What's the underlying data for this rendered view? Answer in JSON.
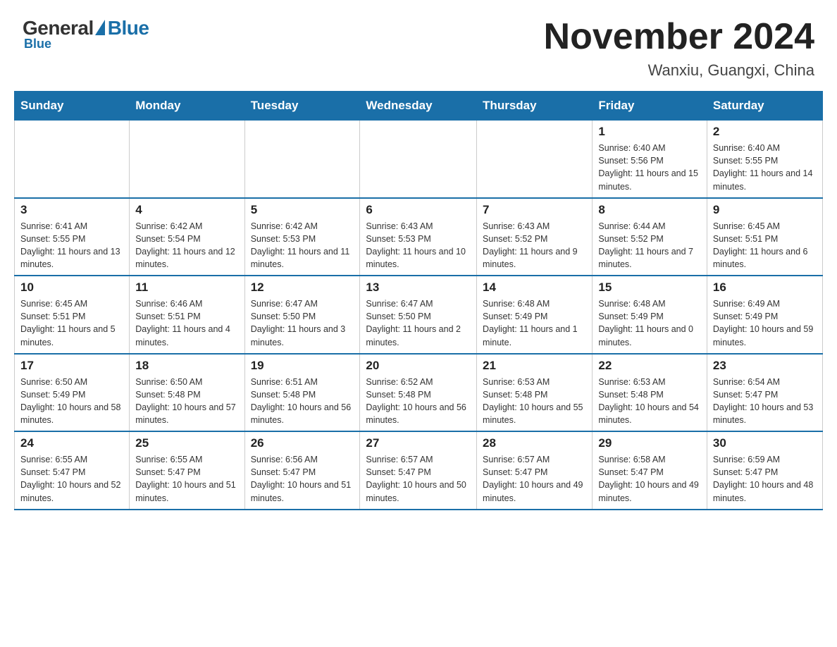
{
  "header": {
    "logo": {
      "general": "General",
      "blue": "Blue"
    },
    "title": "November 2024",
    "subtitle": "Wanxiu, Guangxi, China"
  },
  "days_of_week": [
    "Sunday",
    "Monday",
    "Tuesday",
    "Wednesday",
    "Thursday",
    "Friday",
    "Saturday"
  ],
  "weeks": [
    [
      {
        "day": "",
        "info": ""
      },
      {
        "day": "",
        "info": ""
      },
      {
        "day": "",
        "info": ""
      },
      {
        "day": "",
        "info": ""
      },
      {
        "day": "",
        "info": ""
      },
      {
        "day": "1",
        "info": "Sunrise: 6:40 AM\nSunset: 5:56 PM\nDaylight: 11 hours and 15 minutes."
      },
      {
        "day": "2",
        "info": "Sunrise: 6:40 AM\nSunset: 5:55 PM\nDaylight: 11 hours and 14 minutes."
      }
    ],
    [
      {
        "day": "3",
        "info": "Sunrise: 6:41 AM\nSunset: 5:55 PM\nDaylight: 11 hours and 13 minutes."
      },
      {
        "day": "4",
        "info": "Sunrise: 6:42 AM\nSunset: 5:54 PM\nDaylight: 11 hours and 12 minutes."
      },
      {
        "day": "5",
        "info": "Sunrise: 6:42 AM\nSunset: 5:53 PM\nDaylight: 11 hours and 11 minutes."
      },
      {
        "day": "6",
        "info": "Sunrise: 6:43 AM\nSunset: 5:53 PM\nDaylight: 11 hours and 10 minutes."
      },
      {
        "day": "7",
        "info": "Sunrise: 6:43 AM\nSunset: 5:52 PM\nDaylight: 11 hours and 9 minutes."
      },
      {
        "day": "8",
        "info": "Sunrise: 6:44 AM\nSunset: 5:52 PM\nDaylight: 11 hours and 7 minutes."
      },
      {
        "day": "9",
        "info": "Sunrise: 6:45 AM\nSunset: 5:51 PM\nDaylight: 11 hours and 6 minutes."
      }
    ],
    [
      {
        "day": "10",
        "info": "Sunrise: 6:45 AM\nSunset: 5:51 PM\nDaylight: 11 hours and 5 minutes."
      },
      {
        "day": "11",
        "info": "Sunrise: 6:46 AM\nSunset: 5:51 PM\nDaylight: 11 hours and 4 minutes."
      },
      {
        "day": "12",
        "info": "Sunrise: 6:47 AM\nSunset: 5:50 PM\nDaylight: 11 hours and 3 minutes."
      },
      {
        "day": "13",
        "info": "Sunrise: 6:47 AM\nSunset: 5:50 PM\nDaylight: 11 hours and 2 minutes."
      },
      {
        "day": "14",
        "info": "Sunrise: 6:48 AM\nSunset: 5:49 PM\nDaylight: 11 hours and 1 minute."
      },
      {
        "day": "15",
        "info": "Sunrise: 6:48 AM\nSunset: 5:49 PM\nDaylight: 11 hours and 0 minutes."
      },
      {
        "day": "16",
        "info": "Sunrise: 6:49 AM\nSunset: 5:49 PM\nDaylight: 10 hours and 59 minutes."
      }
    ],
    [
      {
        "day": "17",
        "info": "Sunrise: 6:50 AM\nSunset: 5:49 PM\nDaylight: 10 hours and 58 minutes."
      },
      {
        "day": "18",
        "info": "Sunrise: 6:50 AM\nSunset: 5:48 PM\nDaylight: 10 hours and 57 minutes."
      },
      {
        "day": "19",
        "info": "Sunrise: 6:51 AM\nSunset: 5:48 PM\nDaylight: 10 hours and 56 minutes."
      },
      {
        "day": "20",
        "info": "Sunrise: 6:52 AM\nSunset: 5:48 PM\nDaylight: 10 hours and 56 minutes."
      },
      {
        "day": "21",
        "info": "Sunrise: 6:53 AM\nSunset: 5:48 PM\nDaylight: 10 hours and 55 minutes."
      },
      {
        "day": "22",
        "info": "Sunrise: 6:53 AM\nSunset: 5:48 PM\nDaylight: 10 hours and 54 minutes."
      },
      {
        "day": "23",
        "info": "Sunrise: 6:54 AM\nSunset: 5:47 PM\nDaylight: 10 hours and 53 minutes."
      }
    ],
    [
      {
        "day": "24",
        "info": "Sunrise: 6:55 AM\nSunset: 5:47 PM\nDaylight: 10 hours and 52 minutes."
      },
      {
        "day": "25",
        "info": "Sunrise: 6:55 AM\nSunset: 5:47 PM\nDaylight: 10 hours and 51 minutes."
      },
      {
        "day": "26",
        "info": "Sunrise: 6:56 AM\nSunset: 5:47 PM\nDaylight: 10 hours and 51 minutes."
      },
      {
        "day": "27",
        "info": "Sunrise: 6:57 AM\nSunset: 5:47 PM\nDaylight: 10 hours and 50 minutes."
      },
      {
        "day": "28",
        "info": "Sunrise: 6:57 AM\nSunset: 5:47 PM\nDaylight: 10 hours and 49 minutes."
      },
      {
        "day": "29",
        "info": "Sunrise: 6:58 AM\nSunset: 5:47 PM\nDaylight: 10 hours and 49 minutes."
      },
      {
        "day": "30",
        "info": "Sunrise: 6:59 AM\nSunset: 5:47 PM\nDaylight: 10 hours and 48 minutes."
      }
    ]
  ]
}
